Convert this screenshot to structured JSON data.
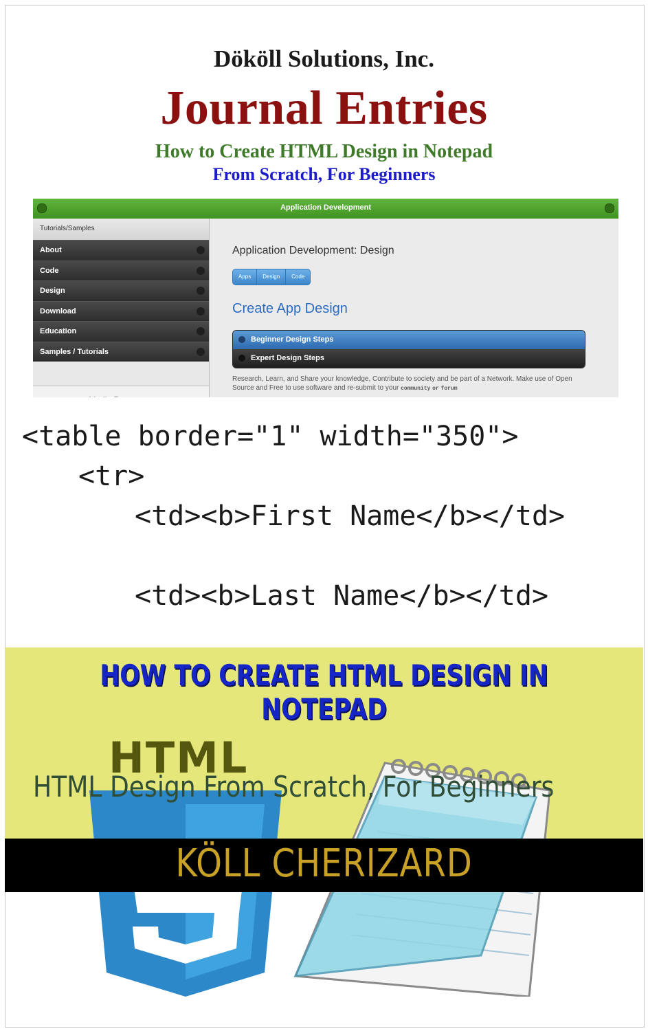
{
  "cover": {
    "publisher": "Dököll Solutions, Inc.",
    "title": "Journal Entries",
    "subtitle_line1": "How to Create HTML Design in Notepad",
    "subtitle_line2": "From Scratch, For Beginners"
  },
  "app_screenshot": {
    "bar_title": "Application Development",
    "sidebar": {
      "header": "Tutorials/Samples",
      "items": [
        "About",
        "Code",
        "Design",
        "Download",
        "Education",
        "Samples / Tutorials"
      ],
      "footer": "Media Resources"
    },
    "content": {
      "title": "Application Development: Design",
      "pills": [
        "Apps",
        "Design",
        "Code"
      ],
      "heading": "Create App Design",
      "steps": [
        "Beginner Design Steps",
        "Expert Design Steps"
      ],
      "paragraph": "Research, Learn, and Share your knowledge, Contribute to society and be part of a Network. Make use of Open Source and Free to use software and re-submit to your",
      "mono1": "community",
      "mono_sep": "or",
      "mono2": "forum"
    }
  },
  "code": {
    "line1": "<table border=\"1\" width=\"350\">",
    "line2": "<tr>",
    "line3": "<td><b>First Name</b></td>",
    "line4": "<td><b>Last Name</b></td>"
  },
  "band": {
    "title": "HOW TO CREATE HTML DESIGN IN NOTEPAD",
    "logo_word": "HTML",
    "subline": "HTML Design From Scratch, For Beginners",
    "author": "KÖLL CHERIZARD"
  },
  "colors": {
    "title_red": "#8b1010",
    "subtitle_green": "#3f7a2a",
    "subtitle_blue": "#1c1cc8",
    "band_yellow": "#e5e77a",
    "band_title_blue": "#1626c6",
    "author_gold": "#c8a126",
    "css_shield_blue": "#2d88c9"
  },
  "icons": [
    "css3-shield-icon",
    "notepad-icon"
  ]
}
